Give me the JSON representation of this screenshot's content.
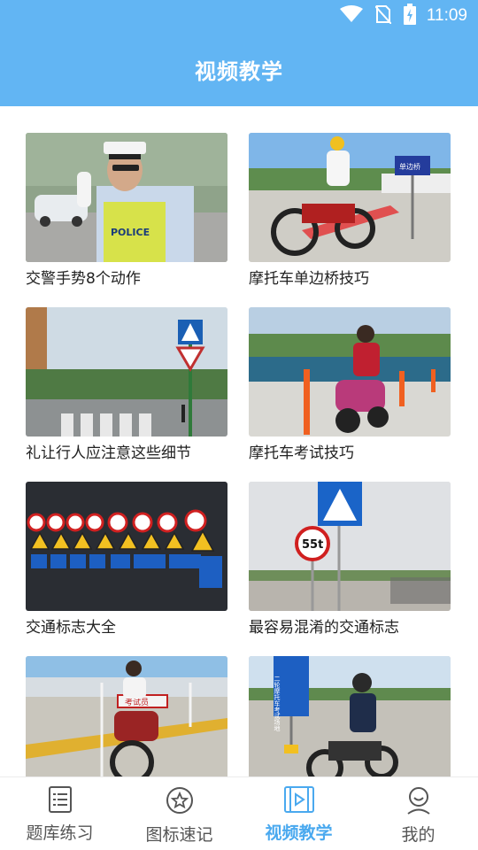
{
  "status_bar": {
    "time": "11:09",
    "icons": [
      "wifi-icon",
      "no-sim-icon",
      "battery-charging-icon"
    ]
  },
  "header": {
    "title": "视频教学"
  },
  "videos": [
    {
      "title": "交警手势8个动作",
      "thumb_text": "POLICE"
    },
    {
      "title": "摩托车单边桥技巧",
      "thumb_text": "单边桥"
    },
    {
      "title": "礼让行人应注意这些细节"
    },
    {
      "title": "摩托车考试技巧"
    },
    {
      "title": "交通标志大全"
    },
    {
      "title": "最容易混淆的交通标志",
      "thumb_text": "55t"
    },
    {
      "title": "",
      "thumb_text": "考试员"
    },
    {
      "title": "",
      "thumb_text": "二轮摩托车考试场地"
    }
  ],
  "tabbar": {
    "items": [
      {
        "label": "题库练习",
        "icon": "list-icon",
        "active": false
      },
      {
        "label": "图标速记",
        "icon": "star-badge-icon",
        "active": false
      },
      {
        "label": "视频教学",
        "icon": "video-icon",
        "active": true
      },
      {
        "label": "我的",
        "icon": "user-icon",
        "active": false
      }
    ]
  },
  "colors": {
    "primary": "#62b5f3",
    "active_tab": "#4aa9ef",
    "text": "#222222"
  }
}
